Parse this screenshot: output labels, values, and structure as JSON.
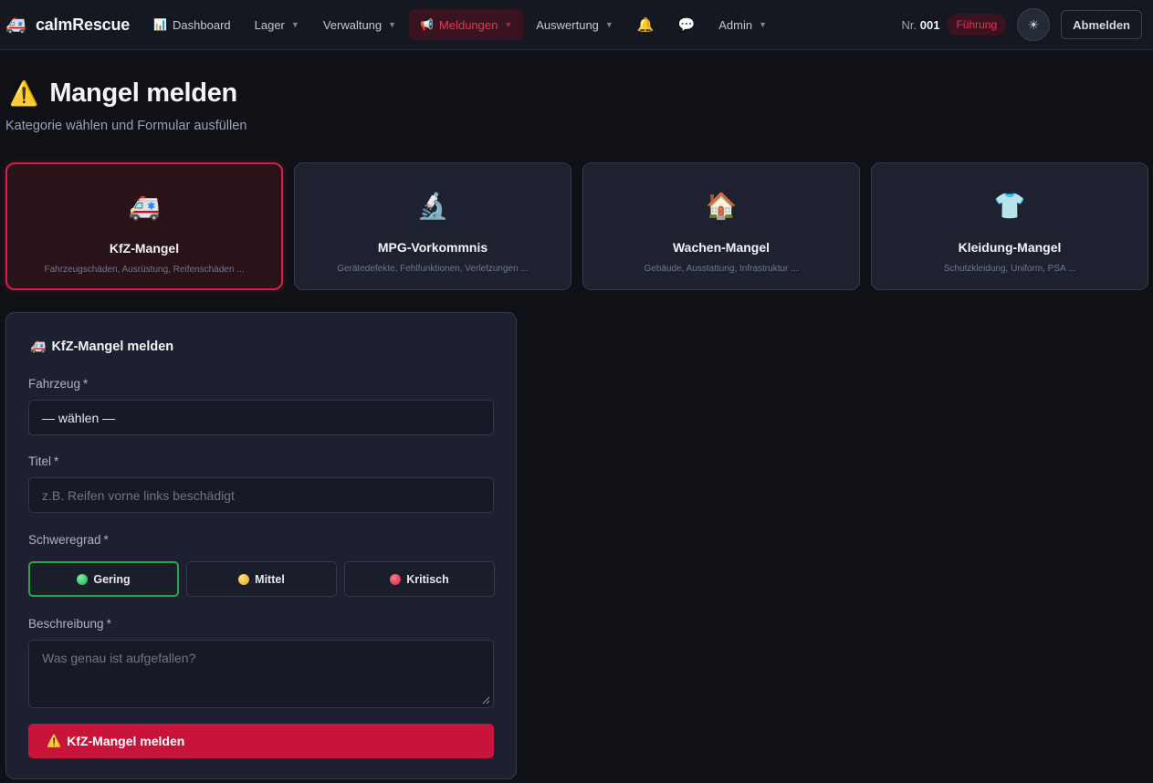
{
  "app": {
    "logo_icon": "ambulance-icon",
    "name": "calmRescue"
  },
  "nav": {
    "items": [
      {
        "label": "Dashboard",
        "icon": "📊",
        "icon_name": "bar-chart-icon",
        "dropdown": false
      },
      {
        "label": "Lager",
        "icon": "",
        "dropdown": true
      },
      {
        "label": "Verwaltung",
        "icon": "",
        "dropdown": true
      },
      {
        "label": "Meldungen",
        "icon": "📢",
        "icon_name": "megaphone-icon",
        "dropdown": true,
        "active": true
      },
      {
        "label": "Auswertung",
        "icon": "",
        "dropdown": true
      },
      {
        "label": "🔔",
        "icon_name": "bell-icon",
        "dropdown": false
      },
      {
        "label": "💬",
        "icon_name": "chat-bubble-icon",
        "dropdown": false
      },
      {
        "label": "Admin",
        "icon": "",
        "dropdown": true
      }
    ]
  },
  "user": {
    "nr_label": "Nr.",
    "nr_value": "001",
    "role": "Führung",
    "theme_icon": "☀",
    "logout_label": "Abmelden"
  },
  "page": {
    "title_icon": "⚠️",
    "title": "Mangel melden",
    "subtitle": "Kategorie wählen und Formular ausfüllen"
  },
  "categories": [
    {
      "icon": "🚑",
      "icon_name": "ambulance-icon",
      "title": "KfZ-Mangel",
      "desc": "Fahrzeugschäden, Ausrüstung, Reifenschäden ...",
      "selected": true
    },
    {
      "icon": "🔬",
      "icon_name": "microscope-icon",
      "title": "MPG-Vorkommnis",
      "desc": "Gerätedefekte, Fehlfunktionen, Verletzungen ...",
      "selected": false
    },
    {
      "icon": "🏠",
      "icon_name": "house-icon",
      "title": "Wachen-Mangel",
      "desc": "Gebäude, Ausstattung, Infrastruktur ...",
      "selected": false
    },
    {
      "icon": "👕",
      "icon_name": "tshirt-icon",
      "title": "Kleidung-Mangel",
      "desc": "Schutzkleidung, Uniform, PSA ...",
      "selected": false
    }
  ],
  "form": {
    "title_icon": "🚑",
    "title": "KfZ-Mangel melden",
    "vehicle_label": "Fahrzeug",
    "vehicle_value": "— wählen —",
    "title_label": "Titel",
    "title_placeholder": "z.B. Reifen vorne links beschädigt",
    "severity_label": "Schweregrad",
    "severity_options": [
      {
        "label": "Gering",
        "color": "green",
        "selected": true
      },
      {
        "label": "Mittel",
        "color": "yellow",
        "selected": false
      },
      {
        "label": "Kritisch",
        "color": "red",
        "selected": false
      }
    ],
    "description_label": "Beschreibung",
    "description_placeholder": "Was genau ist aufgefallen?",
    "required_mark": "*",
    "submit_icon": "⚠️",
    "submit_label": "KfZ-Mangel melden"
  },
  "colors": {
    "accent": "#c8143b",
    "selected_border": "#d81f47",
    "severity_active": "#22a84a"
  }
}
